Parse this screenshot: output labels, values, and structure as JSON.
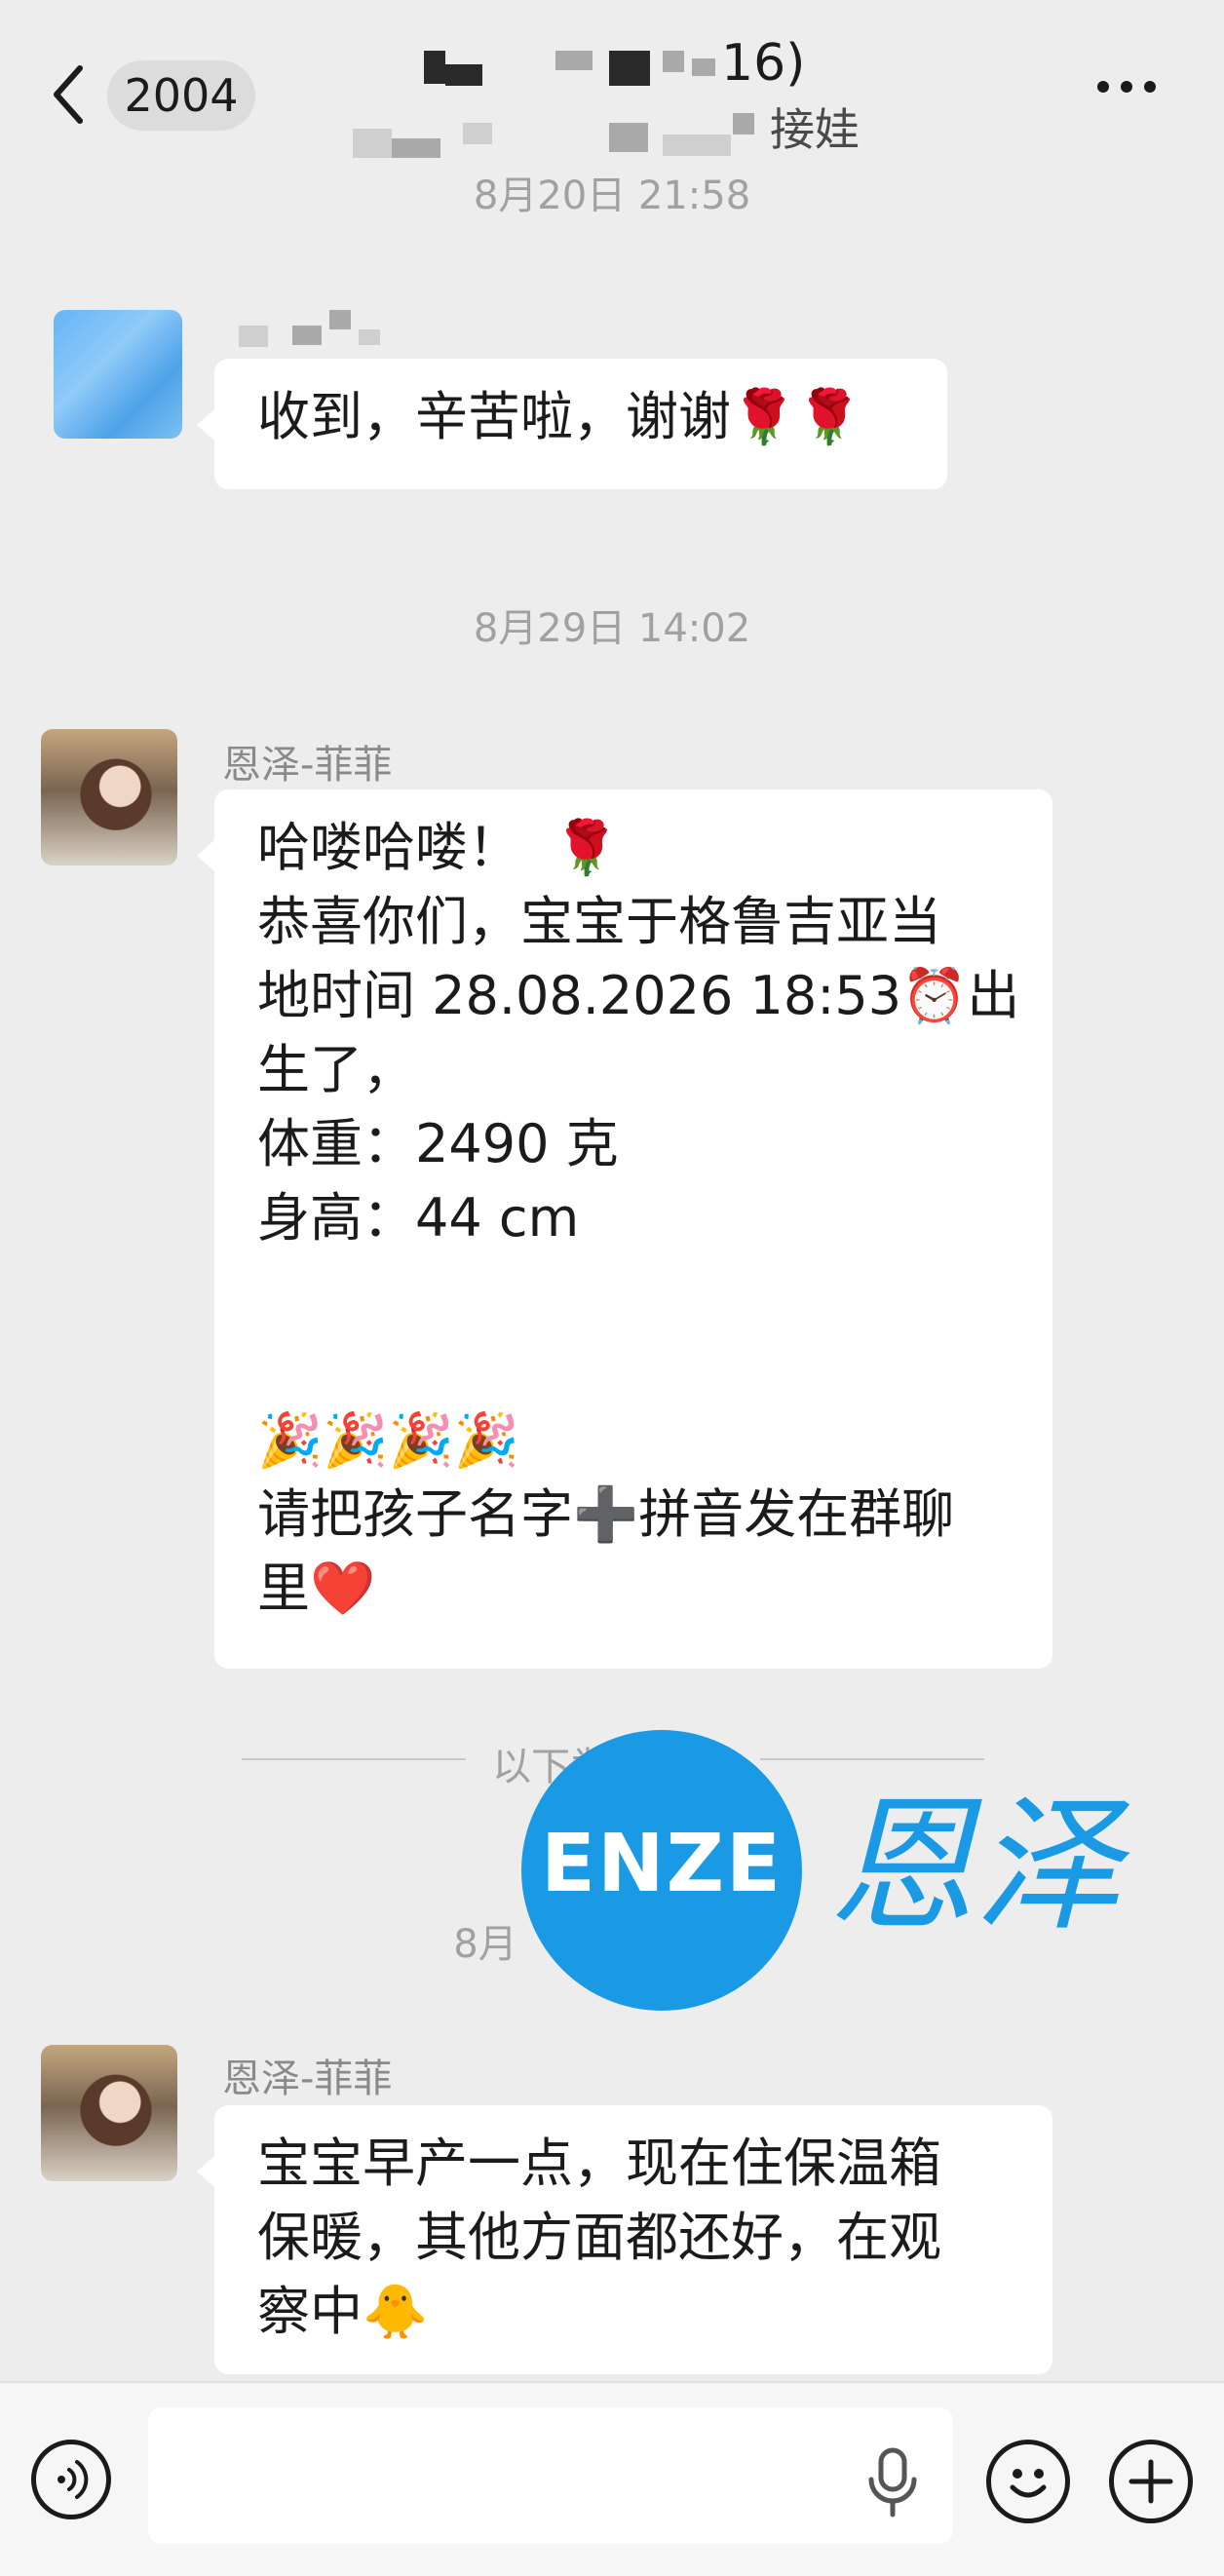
{
  "header": {
    "back_count": "2004",
    "title_suffix": "16)",
    "subtitle_suffix": "接娃"
  },
  "messages": [
    {
      "timestamp": "8月20日 21:58",
      "sender_name": "",
      "lines": [
        "收到，辛苦啦，谢谢🌹🌹"
      ]
    },
    {
      "timestamp": "8月29日 14:02",
      "sender_name": "恩泽-菲菲",
      "lines": [
        "哈喽哈喽！  🌹",
        "恭喜你们，宝宝于格鲁吉亚当",
        "地时间 28.08.2026 18:53⏰出",
        "生了，",
        "体重：2490 克",
        "身高：44 cm",
        "",
        "",
        "🎉🎉🎉🎉",
        "请把孩子名字➕拼音发在群聊",
        "里❤️"
      ]
    },
    {
      "divider": "以下为新消息",
      "timestamp": "8月",
      "sender_name": "恩泽-菲菲",
      "lines": [
        "宝宝早产一点，现在住保温箱",
        "保暖，其他方面都还好，在观",
        "察中🐥"
      ]
    }
  ],
  "watermark": {
    "latin": "ENZE",
    "chinese": "恩泽"
  },
  "input": {
    "placeholder": ""
  },
  "icons": {
    "back": "chevron-left-icon",
    "more": "more-dots-icon",
    "voice": "voice-icon",
    "mic": "microphone-icon",
    "emoji": "emoji-icon",
    "plus": "plus-icon"
  }
}
